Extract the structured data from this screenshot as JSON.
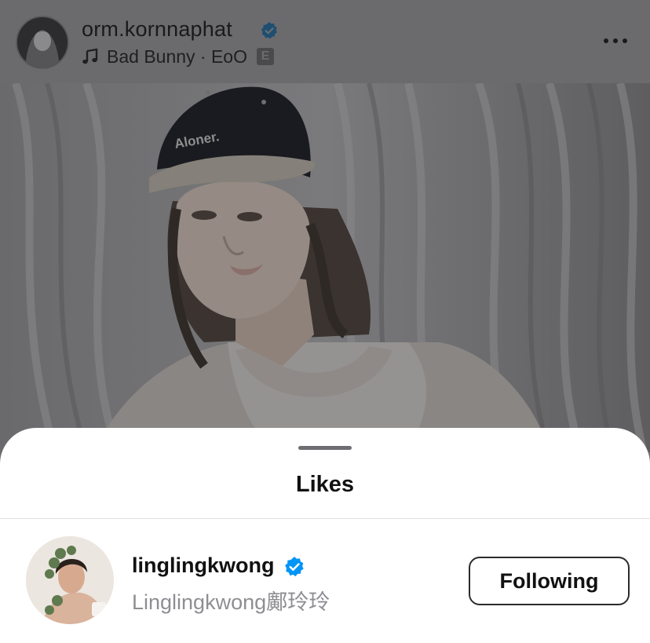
{
  "post": {
    "username": "orm.kornnaphat",
    "verified": true,
    "music": {
      "text": "Bad Bunny · EoO",
      "explicit_label": "E"
    },
    "photo": {
      "cap_text": "Aloner."
    }
  },
  "likes_sheet": {
    "title": "Likes",
    "users": [
      {
        "username": "linglingkwong",
        "verified": true,
        "full_name": "Linglingkwong鄺玲玲",
        "button_label": "Following"
      }
    ]
  },
  "colors": {
    "verified_blue": "#0095f6",
    "overlay_gray": "#6b6b6d",
    "sheet_background": "#ffffff"
  },
  "icons": [
    "verified-badge-icon",
    "music-note-icon",
    "explicit-icon",
    "more-options-icon"
  ]
}
